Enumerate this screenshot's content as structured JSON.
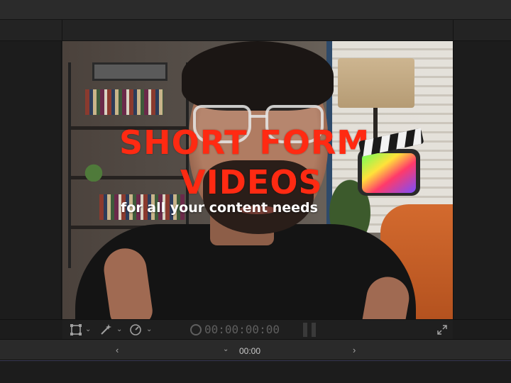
{
  "viewer": {
    "title_line1": "SHORT FORM",
    "title_line2": "VIDEOS",
    "subtitle": "for all your content needs",
    "title_color": "#ff2a12"
  },
  "controls": {
    "transform_icon": "transform-icon",
    "effects_icon": "magic-wand-icon",
    "speed_icon": "speedometer-icon",
    "timecode": "00:00:00:00",
    "fullscreen_icon": "expand-icon"
  },
  "timeline": {
    "current_time": "00:00",
    "prev_icon": "chevron-left-icon",
    "next_icon": "chevron-right-icon",
    "dropdown_icon": "chevron-down-icon"
  }
}
